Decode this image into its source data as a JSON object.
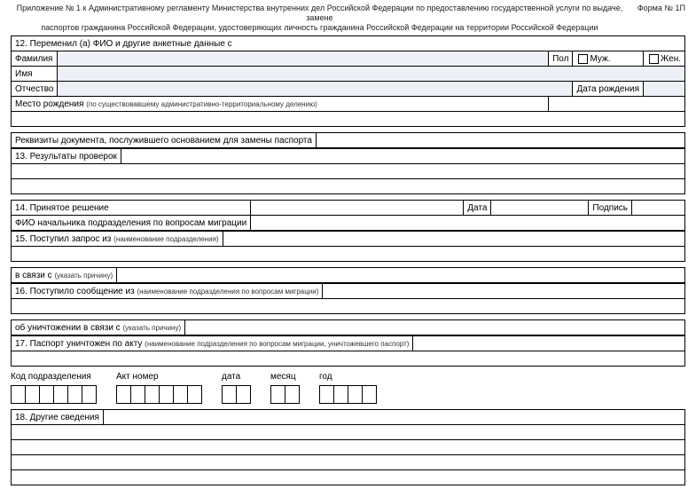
{
  "header": {
    "line1": "Приложение № 1 к Административному регламенту Министерства внутренних дел Российской Федерации по предоставлению государственной услуги по выдаче, замене",
    "line2": "паспортов гражданина Российской Федерации, удостоверяющих личность гражданина Российской Федерации на территории Российской Федерации",
    "form": "Форма № 1П"
  },
  "s12": {
    "title": "12. Переменил (а) ФИО и другие анкетные данные с",
    "surname": "Фамилия",
    "name": "Имя",
    "patronymic": "Отчество",
    "sex": "Пол",
    "male": "Муж.",
    "female": "Жен.",
    "dob": "Дата рождения",
    "pob": "Место рождения",
    "pob_note": "(по существовавшему административно-территориальному делению)",
    "doc_basis": "Реквизиты документа, послужившего основанием для замены паспорта"
  },
  "s13": {
    "title": "13. Результаты проверок"
  },
  "s14": {
    "title": "14. Принятое решение",
    "date": "Дата",
    "sign": "Подпись",
    "chief": "ФИО начальника подразделения по вопросам миграции"
  },
  "s15": {
    "title": "15. Поступил запрос из",
    "title_note": "(наименование подразделения)",
    "reason": "в связи с",
    "reason_note": "(указать причину)"
  },
  "s16": {
    "title": "16. Поступило сообщение из",
    "title_note": "(наименование подразделения по вопросам миграции)",
    "destruction": "об уничтожении в связи с",
    "destruction_note": "(указать причину)"
  },
  "s17": {
    "title": "17. Паспорт уничтожен по акту",
    "title_note": "(наименование подразделения по вопросам миграции, уничтожевшего паспорт)"
  },
  "codes": {
    "dept": "Код подразделения",
    "act": "Акт номер",
    "date": "дата",
    "month": "месяц",
    "year": "год",
    "dept_boxes": 6,
    "act_boxes": 6,
    "date_boxes": 2,
    "month_boxes": 2,
    "year_boxes": 4
  },
  "s18": {
    "title": "18. Другие сведения"
  }
}
